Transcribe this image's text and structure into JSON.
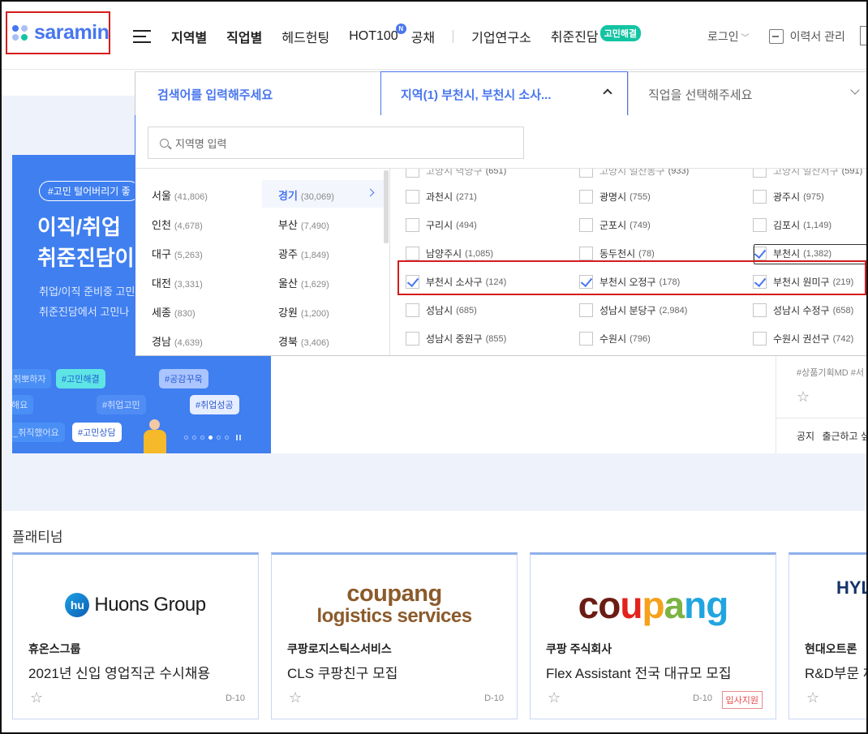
{
  "header": {
    "logo_text": "saramin",
    "logo_dot_colors": [
      "#4876ef",
      "#a9bff5",
      "#a9bff5",
      "#13c4a3"
    ],
    "nav": [
      "지역별",
      "직업별",
      "헤드헌팅",
      "HOT100",
      "공채",
      "기업연구소",
      "취준진담"
    ],
    "hot_badge": "N",
    "green_badge": "고민해결",
    "login": "로그인",
    "resume": "이력서 관리"
  },
  "search": {
    "keyword_tab": "검색어를 입력해주세요",
    "region_tab": "지역(1) 부천시, 부천시 소사...",
    "job_tab": "직업을 선택해주세요",
    "region_placeholder": "지역명 입력"
  },
  "provinces": [
    {
      "name": "서울",
      "count": "(41,806)"
    },
    {
      "name": "경기",
      "count": "(30,069)",
      "selected": true
    },
    {
      "name": "인천",
      "count": "(4,678)"
    },
    {
      "name": "부산",
      "count": "(7,490)"
    },
    {
      "name": "대구",
      "count": "(5,263)"
    },
    {
      "name": "광주",
      "count": "(1,849)"
    },
    {
      "name": "대전",
      "count": "(3,331)"
    },
    {
      "name": "울산",
      "count": "(1,629)"
    },
    {
      "name": "세종",
      "count": "(830)"
    },
    {
      "name": "강원",
      "count": "(1,200)"
    },
    {
      "name": "경남",
      "count": "(4,639)"
    },
    {
      "name": "경북",
      "count": "(3,406)"
    }
  ],
  "districts": [
    {
      "name": "고양시 덕양구",
      "count": "(651)",
      "checked": false
    },
    {
      "name": "고양시 일산동구",
      "count": "(933)",
      "checked": false
    },
    {
      "name": "고양시 일산서구",
      "count": "(591)",
      "checked": false
    },
    {
      "name": "과천시",
      "count": "(271)",
      "checked": false
    },
    {
      "name": "광명시",
      "count": "(755)",
      "checked": false
    },
    {
      "name": "광주시",
      "count": "(975)",
      "checked": false
    },
    {
      "name": "구리시",
      "count": "(494)",
      "checked": false
    },
    {
      "name": "군포시",
      "count": "(749)",
      "checked": false
    },
    {
      "name": "김포시",
      "count": "(1,149)",
      "checked": false
    },
    {
      "name": "남양주시",
      "count": "(1,085)",
      "checked": false
    },
    {
      "name": "동두천시",
      "count": "(78)",
      "checked": false
    },
    {
      "name": "부천시",
      "count": "(1,382)",
      "checked": true
    },
    {
      "name": "부천시 소사구",
      "count": "(124)",
      "checked": true
    },
    {
      "name": "부천시 오정구",
      "count": "(178)",
      "checked": true
    },
    {
      "name": "부천시 원미구",
      "count": "(219)",
      "checked": true
    },
    {
      "name": "성남시",
      "count": "(685)",
      "checked": false
    },
    {
      "name": "성남시 분당구",
      "count": "(2,984)",
      "checked": false
    },
    {
      "name": "성남시 수정구",
      "count": "(658)",
      "checked": false
    },
    {
      "name": "성남시 중원구",
      "count": "(855)",
      "checked": false
    },
    {
      "name": "수원시",
      "count": "(796)",
      "checked": false
    },
    {
      "name": "수원시 권선구",
      "count": "(742)",
      "checked": false
    }
  ],
  "banner": {
    "pill": "#고민 털어버리기 좋",
    "headline1": "이직/취업",
    "headline2": "취준진담이",
    "desc1": "취업/이직 준비중 고민",
    "desc2": "취준진담에서 고민나",
    "tags": [
      "취뽀하자",
      "#고민해결",
      "#공감꾸욱",
      "해요",
      "#취업고민",
      "#취업성공",
      "_취직했어요",
      "#고민상담"
    ]
  },
  "side_card": {
    "tags": "#상품기획MD #서",
    "notice_label": "공지",
    "notice_text": "출근하고 싶"
  },
  "platinum": {
    "title": "플래티넘",
    "cards": [
      {
        "logo_text": "Huons Group",
        "logo_mark": "hu",
        "company": "휴온스그룹",
        "title": "2021년 신입 영업직군 수시채용",
        "dday": "D-10",
        "apply": ""
      },
      {
        "logo_text": "coupang",
        "logo_sub": "logistics services",
        "company": "쿠팡로지스틱스서비스",
        "title": "CLS 쿠팡친구 모집",
        "dday": "D-10",
        "apply": ""
      },
      {
        "logo_text": "coupang",
        "company": "쿠팡 주식회사",
        "title": "Flex Assistant 전국 대규모 모집",
        "dday": "D-10",
        "apply": "입사지원"
      },
      {
        "logo_text": "HYL",
        "company": "현대오트론",
        "title": "R&D부문 채",
        "dday": "",
        "apply": ""
      }
    ]
  },
  "colors": {
    "brand": "#4876ef",
    "accent_green": "#13c4a3",
    "annotation_red": "#d61c1c"
  }
}
